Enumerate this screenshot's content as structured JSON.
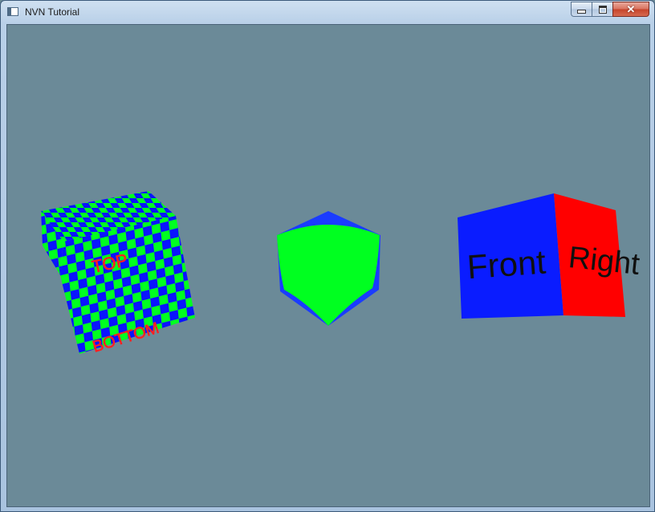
{
  "window": {
    "title": "NVN Tutorial"
  },
  "caption_buttons": {
    "minimize": "minimize-icon",
    "maximize": "maximize-icon",
    "close": "close-icon"
  },
  "scene": {
    "background_color": "#6b8a98",
    "left_cube": {
      "top_label": "TOP",
      "bottom_label": "BOTTOM",
      "colors": [
        "#00ff20",
        "#0a14ff",
        "#ff2020"
      ]
    },
    "middle_object": {
      "colors": [
        "#00ff20",
        "#1a3cff"
      ]
    },
    "right_cube": {
      "front_label": "Front",
      "right_label": "Right",
      "colors": [
        "#0a1cff",
        "#ff0000",
        "#101010"
      ]
    }
  }
}
